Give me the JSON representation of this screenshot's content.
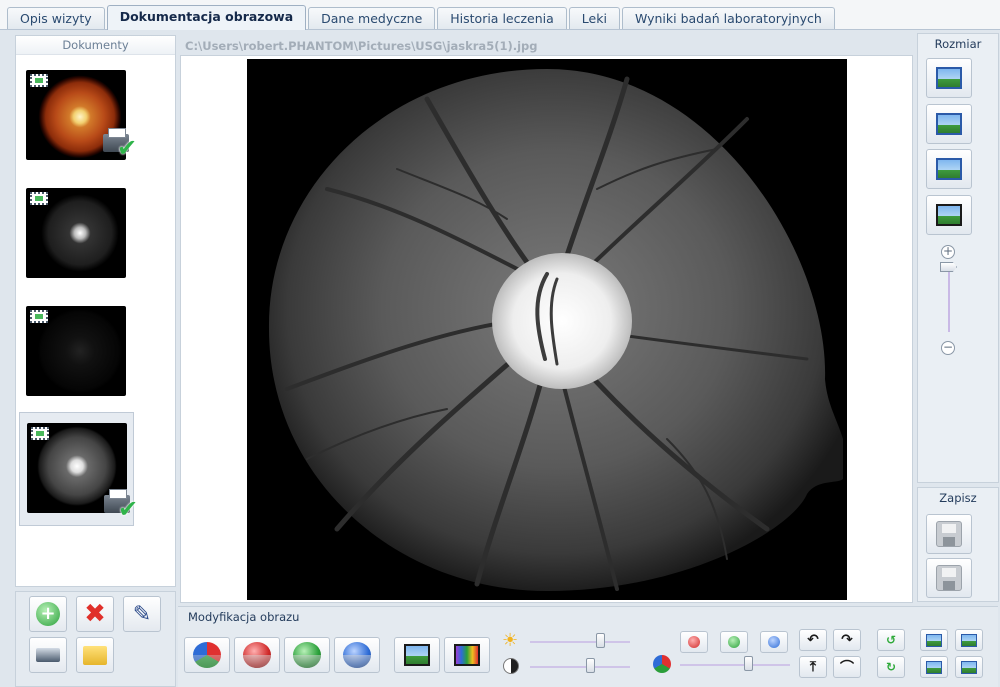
{
  "tabs": [
    {
      "label": "Opis wizyty",
      "active": false
    },
    {
      "label": "Dokumentacja obrazowa",
      "active": true
    },
    {
      "label": "Dane medyczne",
      "active": false
    },
    {
      "label": "Historia leczenia",
      "active": false
    },
    {
      "label": "Leki",
      "active": false
    },
    {
      "label": "Wyniki badań laboratoryjnych",
      "active": false
    }
  ],
  "documents": {
    "header": "Dokumenty",
    "items": [
      {
        "type": "color-fundus",
        "printed": true,
        "selected": false
      },
      {
        "type": "dark-fundus",
        "printed": false,
        "selected": false
      },
      {
        "type": "very-dark-fundus",
        "printed": false,
        "selected": false
      },
      {
        "type": "grayscale-fundus",
        "printed": true,
        "selected": true
      }
    ]
  },
  "image": {
    "path": "C:\\Users\\robert.PHANTOM\\Pictures\\USG\\jaskra5(1).jpg"
  },
  "right_panel": {
    "size_label": "Rozmiar",
    "save_label": "Zapisz"
  },
  "modification": {
    "title": "Modyfikacja obrazu",
    "brightness": 0.7,
    "contrast": 0.6,
    "color_balance": 0.62
  },
  "colors": {
    "accent": "#2b5aa8",
    "tab_active_bg": "#eef3f8",
    "panel_bg": "#dfe6ed"
  }
}
